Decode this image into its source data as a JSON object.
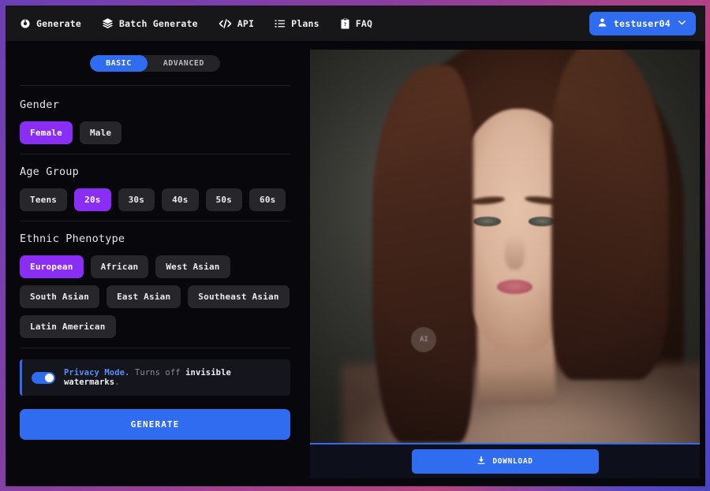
{
  "nav": {
    "items": [
      {
        "label": "Generate",
        "icon": "aperture-icon"
      },
      {
        "label": "Batch Generate",
        "icon": "layers-icon"
      },
      {
        "label": "API",
        "icon": "code-icon"
      },
      {
        "label": "Plans",
        "icon": "list-icon"
      },
      {
        "label": "FAQ",
        "icon": "clipboard-question-icon"
      }
    ],
    "user": {
      "name": "testuser04",
      "avatar_icon": "user-icon",
      "chevron_icon": "chevron-down-icon"
    }
  },
  "panel": {
    "mode_tabs": [
      {
        "label": "BASIC",
        "active": true
      },
      {
        "label": "ADVANCED",
        "active": false
      }
    ],
    "sections": [
      {
        "title": "Gender",
        "options": [
          {
            "label": "Female",
            "selected": true
          },
          {
            "label": "Male",
            "selected": false
          }
        ]
      },
      {
        "title": "Age Group",
        "options": [
          {
            "label": "Teens",
            "selected": false
          },
          {
            "label": "20s",
            "selected": true
          },
          {
            "label": "30s",
            "selected": false
          },
          {
            "label": "40s",
            "selected": false
          },
          {
            "label": "50s",
            "selected": false
          },
          {
            "label": "60s",
            "selected": false
          }
        ]
      },
      {
        "title": "Ethnic Phenotype",
        "options": [
          {
            "label": "European",
            "selected": true
          },
          {
            "label": "African",
            "selected": false
          },
          {
            "label": "West Asian",
            "selected": false
          },
          {
            "label": "South Asian",
            "selected": false
          },
          {
            "label": "East Asian",
            "selected": false
          },
          {
            "label": "Southeast Asian",
            "selected": false
          },
          {
            "label": "Latin American",
            "selected": false
          }
        ]
      }
    ],
    "privacy": {
      "toggle_on": true,
      "label": "Privacy Mode.",
      "description_muted": " Turns off ",
      "description_strong": "invisible watermarks",
      "description_end": "."
    },
    "generate_label": "GENERATE"
  },
  "preview": {
    "image_alt": "generated portrait of a young woman with long brown hair on a grey studio backdrop",
    "watermark_text": "AI",
    "download_label": "DOWNLOAD",
    "download_icon": "download-icon"
  },
  "colors": {
    "accent_blue": "#2f6cf0",
    "accent_purple": "#8b2ef5",
    "nav_bg": "#17171a",
    "page_bg": "#07070c",
    "chip_bg": "#27272b",
    "frame_gradient_start": "#6b3fb5",
    "frame_gradient_end": "#4a44bf"
  }
}
